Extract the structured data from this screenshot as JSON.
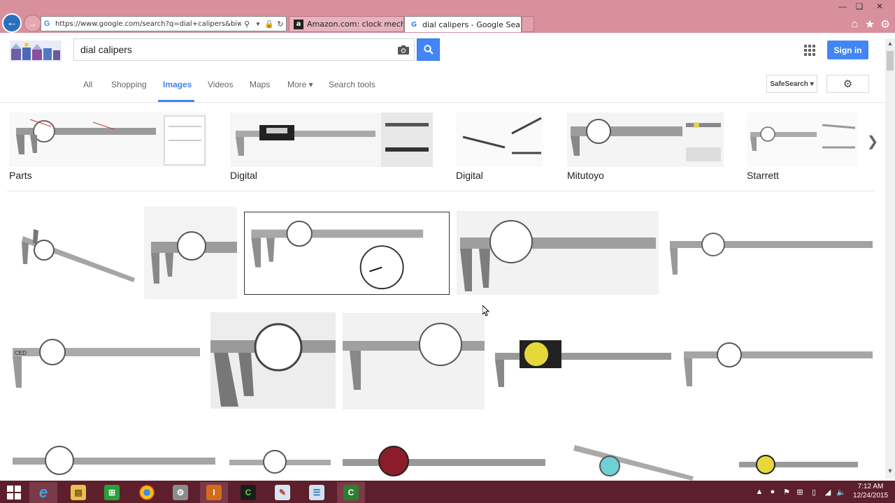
{
  "browser": {
    "url": "https://www.google.com/search?q=dial+calipers&biw=15",
    "tabs": [
      {
        "title": "Amazon.com: clock mechanism",
        "favicon": "amazon-icon"
      },
      {
        "title": "dial calipers - Google Search",
        "favicon": "google-icon",
        "active": true
      }
    ],
    "window_controls": [
      "minimize",
      "restore",
      "close"
    ]
  },
  "google": {
    "query": "dial calipers",
    "signin_label": "Sign in",
    "tabs": [
      {
        "label": "All"
      },
      {
        "label": "Shopping"
      },
      {
        "label": "Images",
        "active": true
      },
      {
        "label": "Videos"
      },
      {
        "label": "Maps"
      },
      {
        "label": "More ▾"
      },
      {
        "label": "Search tools"
      }
    ],
    "safesearch_label": "SafeSearch ▾",
    "accent": "#4285f4"
  },
  "related": [
    {
      "label": "Parts"
    },
    {
      "label": "Digital"
    },
    {
      "label": "Digital"
    },
    {
      "label": "Mitutoyo"
    },
    {
      "label": "Starrett"
    }
  ],
  "taskbar": {
    "time": "7:12 AM",
    "date": "12/24/2015",
    "apps": [
      "windows-start",
      "internet-explorer",
      "file-explorer",
      "store",
      "chrome",
      "utility",
      "pro-app",
      "c-app",
      "paint",
      "notepad",
      "c-app-2"
    ]
  }
}
